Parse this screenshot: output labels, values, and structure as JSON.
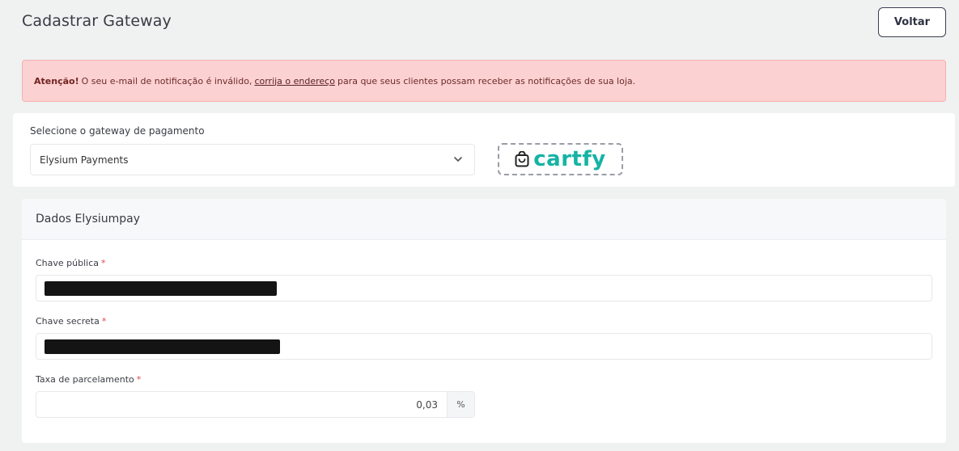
{
  "header": {
    "title": "Cadastrar Gateway",
    "back_label": "Voltar"
  },
  "alert": {
    "strong": "Atenção!",
    "text_before": "O seu e-mail de notificação é inválido,",
    "link": "corrija o endereço",
    "text_after": "para que seus clientes possam receber as notificações de sua loja.",
    "color": "#fcd1d1"
  },
  "gateway": {
    "label": "Selecione o gateway de pagamento",
    "selected": "Elysium Payments",
    "logo_text": "cartfy",
    "logo_color": "#16b3a4"
  },
  "form": {
    "title": "Dados Elysiumpay",
    "public_key": {
      "label": "Chave pública",
      "required": "*",
      "value_state": "redacted"
    },
    "secret_key": {
      "label": "Chave secreta",
      "required": "*",
      "value_state": "redacted"
    },
    "installment_rate": {
      "label": "Taxa de parcelamento",
      "required": "*",
      "value": "0,03",
      "suffix": "%"
    }
  }
}
